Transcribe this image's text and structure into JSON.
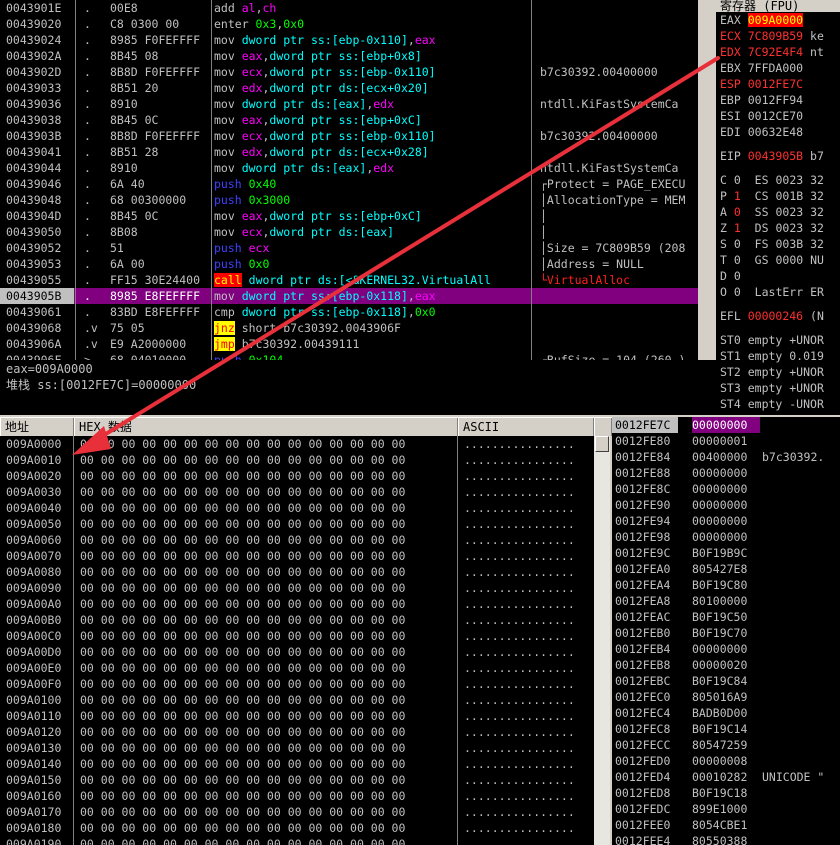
{
  "disasm": [
    {
      "addr": "0043901E",
      "mark": ".",
      "hex": "00E8",
      "asm": [
        [
          "m",
          "add "
        ],
        [
          "k",
          "al"
        ],
        [
          "t",
          ","
        ],
        [
          "k",
          "ch"
        ]
      ],
      "comment": ""
    },
    {
      "addr": "00439020",
      "mark": ".",
      "hex": "C8 0300 00",
      "asm": [
        [
          "m",
          "enter "
        ],
        [
          "n",
          "0x3"
        ],
        [
          "t",
          ","
        ],
        [
          "n",
          "0x0"
        ]
      ],
      "comment": ""
    },
    {
      "addr": "00439024",
      "mark": ".",
      "hex": "8985 F0FEFFFF",
      "asm": [
        [
          "m",
          "mov "
        ],
        [
          "c",
          "dword ptr ss:[ebp-0x110]"
        ],
        [
          "t",
          ","
        ],
        [
          "k",
          "eax"
        ]
      ],
      "comment": ""
    },
    {
      "addr": "0043902A",
      "mark": ".",
      "hex": "8B45 08",
      "asm": [
        [
          "m",
          "mov "
        ],
        [
          "k",
          "eax"
        ],
        [
          "t",
          ","
        ],
        [
          "c",
          "dword ptr ss:[ebp+0x8]"
        ]
      ],
      "comment": ""
    },
    {
      "addr": "0043902D",
      "mark": ".",
      "hex": "8B8D F0FEFFFF",
      "asm": [
        [
          "m",
          "mov "
        ],
        [
          "k",
          "ecx"
        ],
        [
          "t",
          ","
        ],
        [
          "c",
          "dword ptr ss:[ebp-0x110]"
        ]
      ],
      "comment": "b7c30392.00400000"
    },
    {
      "addr": "00439033",
      "mark": ".",
      "hex": "8B51 20",
      "asm": [
        [
          "m",
          "mov "
        ],
        [
          "k",
          "edx"
        ],
        [
          "t",
          ","
        ],
        [
          "c",
          "dword ptr ds:[ecx+0x20]"
        ]
      ],
      "comment": ""
    },
    {
      "addr": "00439036",
      "mark": ".",
      "hex": "8910",
      "asm": [
        [
          "m",
          "mov "
        ],
        [
          "c",
          "dword ptr ds:[eax]"
        ],
        [
          "t",
          ","
        ],
        [
          "k",
          "edx"
        ]
      ],
      "comment": "ntdll.KiFastSystemCa"
    },
    {
      "addr": "00439038",
      "mark": ".",
      "hex": "8B45 0C",
      "asm": [
        [
          "m",
          "mov "
        ],
        [
          "k",
          "eax"
        ],
        [
          "t",
          ","
        ],
        [
          "c",
          "dword ptr ss:[ebp+0xC]"
        ]
      ],
      "comment": ""
    },
    {
      "addr": "0043903B",
      "mark": ".",
      "hex": "8B8D F0FEFFFF",
      "asm": [
        [
          "m",
          "mov "
        ],
        [
          "k",
          "ecx"
        ],
        [
          "t",
          ","
        ],
        [
          "c",
          "dword ptr ss:[ebp-0x110]"
        ]
      ],
      "comment": "b7c30392.00400000"
    },
    {
      "addr": "00439041",
      "mark": ".",
      "hex": "8B51 28",
      "asm": [
        [
          "m",
          "mov "
        ],
        [
          "k",
          "edx"
        ],
        [
          "t",
          ","
        ],
        [
          "c",
          "dword ptr ds:[ecx+0x28]"
        ]
      ],
      "comment": ""
    },
    {
      "addr": "00439044",
      "mark": ".",
      "hex": "8910",
      "asm": [
        [
          "m",
          "mov "
        ],
        [
          "c",
          "dword ptr ds:[eax]"
        ],
        [
          "t",
          ","
        ],
        [
          "k",
          "edx"
        ]
      ],
      "comment": "ntdll.KiFastSystemCa"
    },
    {
      "addr": "00439046",
      "mark": ".",
      "hex": "6A 40",
      "asm": [
        [
          "p",
          "push "
        ],
        [
          "n",
          "0x40"
        ]
      ],
      "comment": "┌Protect = PAGE_EXECU"
    },
    {
      "addr": "00439048",
      "mark": ".",
      "hex": "68 00300000",
      "asm": [
        [
          "p",
          "push "
        ],
        [
          "n",
          "0x3000"
        ]
      ],
      "comment": "│AllocationType = MEM"
    },
    {
      "addr": "0043904D",
      "mark": ".",
      "hex": "8B45 0C",
      "asm": [
        [
          "m",
          "mov "
        ],
        [
          "k",
          "eax"
        ],
        [
          "t",
          ","
        ],
        [
          "c",
          "dword ptr ss:[ebp+0xC]"
        ]
      ],
      "comment": "│"
    },
    {
      "addr": "00439050",
      "mark": ".",
      "hex": "8B08",
      "asm": [
        [
          "m",
          "mov "
        ],
        [
          "k",
          "ecx"
        ],
        [
          "t",
          ","
        ],
        [
          "c",
          "dword ptr ds:[eax]"
        ]
      ],
      "comment": "│"
    },
    {
      "addr": "00439052",
      "mark": ".",
      "hex": "51",
      "asm": [
        [
          "p",
          "push "
        ],
        [
          "k",
          "ecx"
        ]
      ],
      "comment": "│Size = 7C809B59 (208"
    },
    {
      "addr": "00439053",
      "mark": ".",
      "hex": "6A 00",
      "asm": [
        [
          "p",
          "push "
        ],
        [
          "n",
          "0x0"
        ]
      ],
      "comment": "│Address = NULL"
    },
    {
      "addr": "00439055",
      "mark": ".",
      "hex": "FF15 30E24400",
      "asm": [
        [
          "call",
          "call"
        ],
        [
          "m",
          " "
        ],
        [
          "c",
          "dword ptr ds:[<&KERNEL32.VirtualAll"
        ]
      ],
      "comment": "└VirtualAlloc",
      "ccol": "red"
    },
    {
      "addr": "0043905B",
      "mark": ".",
      "hex": "8985 E8FEFFFF",
      "asm": [
        [
          "m",
          "mov "
        ],
        [
          "c",
          "dword ptr ss:[ebp-0x118]"
        ],
        [
          "t",
          ","
        ],
        [
          "k",
          "eax"
        ]
      ],
      "comment": "",
      "sel": true
    },
    {
      "addr": "00439061",
      "mark": ".",
      "hex": "83BD E8FEFFFF",
      "asm": [
        [
          "m",
          "cmp "
        ],
        [
          "c",
          "dword ptr ss:[ebp-0x118]"
        ],
        [
          "t",
          ","
        ],
        [
          "n",
          "0x0"
        ]
      ],
      "comment": ""
    },
    {
      "addr": "00439068",
      "mark": ".v",
      "hex": "75 05",
      "asm": [
        [
          "jmp",
          "jnz"
        ],
        [
          "t",
          " short b7c30392.0043906F"
        ]
      ],
      "comment": ""
    },
    {
      "addr": "0043906A",
      "mark": ".v",
      "hex": "E9 A2000000",
      "asm": [
        [
          "jmp",
          "jmp"
        ],
        [
          "t",
          " b7c30392.00439111"
        ]
      ],
      "comment": ""
    },
    {
      "addr": "0043906F",
      "mark": ">",
      "hex": "68 04010000",
      "asm": [
        [
          "p",
          "push "
        ],
        [
          "n",
          "0x104"
        ]
      ],
      "comment": "┌BufSize = 104 (260.)"
    }
  ],
  "info": {
    "line1": "eax=009A0000",
    "line2": "堆栈 ss:[0012FE7C]=00000000"
  },
  "registers": {
    "title": "寄存器 (FPU)",
    "gp": [
      {
        "n": "EAX",
        "v": "009A0000",
        "t": "",
        "hl": true
      },
      {
        "n": "ECX",
        "v": "7C809B59",
        "t": "ke",
        "red": true
      },
      {
        "n": "EDX",
        "v": "7C92E4F4",
        "t": "nt",
        "red": true
      },
      {
        "n": "EBX",
        "v": "7FFDA000",
        "t": ""
      },
      {
        "n": "ESP",
        "v": "0012FE7C",
        "t": "",
        "red": true
      },
      {
        "n": "EBP",
        "v": "0012FF94",
        "t": ""
      },
      {
        "n": "ESI",
        "v": "0012CE70",
        "t": ""
      },
      {
        "n": "EDI",
        "v": "00632E48",
        "t": ""
      }
    ],
    "eip": {
      "n": "EIP",
      "v": "0043905B",
      "t": "b7"
    },
    "flags": [
      {
        "f": "C",
        "b": "0",
        "seg": "ES",
        "sv": "0023",
        "sx": "32"
      },
      {
        "f": "P",
        "b": "1",
        "seg": "CS",
        "sv": "001B",
        "sx": "32"
      },
      {
        "f": "A",
        "b": "0",
        "seg": "SS",
        "sv": "0023",
        "sx": "32"
      },
      {
        "f": "Z",
        "b": "1",
        "seg": "DS",
        "sv": "0023",
        "sx": "32"
      },
      {
        "f": "S",
        "b": "0",
        "seg": "FS",
        "sv": "003B",
        "sx": "32"
      },
      {
        "f": "T",
        "b": "0",
        "seg": "GS",
        "sv": "0000",
        "sx": "NU"
      },
      {
        "f": "D",
        "b": "0",
        "seg": "",
        "sv": "",
        "sx": ""
      },
      {
        "f": "O",
        "b": "0",
        "seg": "LastErr",
        "sv": "ER",
        "sx": ""
      }
    ],
    "efl": {
      "n": "EFL",
      "v": "00000246",
      "t": "(N"
    },
    "fpu": [
      {
        "n": "ST0",
        "t": "empty +UNOR"
      },
      {
        "n": "ST1",
        "t": "empty 0.019"
      },
      {
        "n": "ST2",
        "t": "empty +UNOR"
      },
      {
        "n": "ST3",
        "t": "empty +UNOR"
      },
      {
        "n": "ST4",
        "t": "empty -UNOR"
      }
    ]
  },
  "dump": {
    "headers": {
      "addr": "地址",
      "hex": "HEX 数据",
      "ascii": "ASCII"
    },
    "hex_line": "00 00 00 00 00 00 00 00 00 00 00 00 00 00 00 00",
    "ascii_line": "................",
    "rows": [
      "009A0000",
      "009A0010",
      "009A0020",
      "009A0030",
      "009A0040",
      "009A0050",
      "009A0060",
      "009A0070",
      "009A0080",
      "009A0090",
      "009A00A0",
      "009A00B0",
      "009A00C0",
      "009A00D0",
      "009A00E0",
      "009A00F0",
      "009A0100",
      "009A0110",
      "009A0120",
      "009A0130",
      "009A0140",
      "009A0150",
      "009A0160",
      "009A0170",
      "009A0180",
      "009A0190"
    ]
  },
  "stack": [
    {
      "a": "0012FE7C",
      "v": "00000000",
      "c": "",
      "sel": true
    },
    {
      "a": "0012FE80",
      "v": "00000001",
      "c": ""
    },
    {
      "a": "0012FE84",
      "v": "00400000",
      "c": "b7c30392."
    },
    {
      "a": "0012FE88",
      "v": "00000000",
      "c": ""
    },
    {
      "a": "0012FE8C",
      "v": "00000000",
      "c": ""
    },
    {
      "a": "0012FE90",
      "v": "00000000",
      "c": ""
    },
    {
      "a": "0012FE94",
      "v": "00000000",
      "c": ""
    },
    {
      "a": "0012FE98",
      "v": "00000000",
      "c": ""
    },
    {
      "a": "0012FE9C",
      "v": "B0F19B9C",
      "c": ""
    },
    {
      "a": "0012FEA0",
      "v": "805427E8",
      "c": ""
    },
    {
      "a": "0012FEA4",
      "v": "B0F19C80",
      "c": ""
    },
    {
      "a": "0012FEA8",
      "v": "80100000",
      "c": ""
    },
    {
      "a": "0012FEAC",
      "v": "B0F19C50",
      "c": ""
    },
    {
      "a": "0012FEB0",
      "v": "B0F19C70",
      "c": ""
    },
    {
      "a": "0012FEB4",
      "v": "00000000",
      "c": ""
    },
    {
      "a": "0012FEB8",
      "v": "00000020",
      "c": ""
    },
    {
      "a": "0012FEBC",
      "v": "B0F19C84",
      "c": ""
    },
    {
      "a": "0012FEC0",
      "v": "805016A9",
      "c": ""
    },
    {
      "a": "0012FEC4",
      "v": "BADB0D00",
      "c": ""
    },
    {
      "a": "0012FEC8",
      "v": "B0F19C14",
      "c": ""
    },
    {
      "a": "0012FECC",
      "v": "80547259",
      "c": ""
    },
    {
      "a": "0012FED0",
      "v": "00000008",
      "c": ""
    },
    {
      "a": "0012FED4",
      "v": "00010282",
      "c": "UNICODE \""
    },
    {
      "a": "0012FED8",
      "v": "B0F19C18",
      "c": ""
    },
    {
      "a": "0012FEDC",
      "v": "899E1000",
      "c": ""
    },
    {
      "a": "0012FEE0",
      "v": "8054CBE1",
      "c": ""
    },
    {
      "a": "0012FEE4",
      "v": "80550388",
      "c": ""
    }
  ],
  "colors": {
    "background": "#000000",
    "selection": "#800080",
    "accent_red": "#ff0000",
    "annotation_arrow": "#e8303a"
  }
}
